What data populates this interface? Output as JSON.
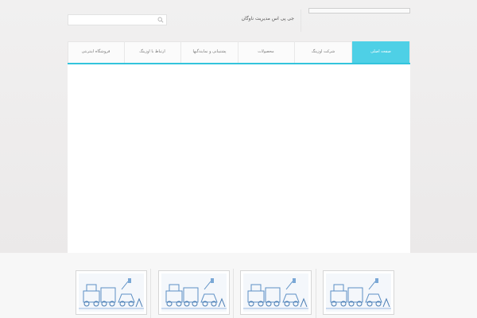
{
  "header": {
    "site_title": "جی پی اس مدیریت ناوگان",
    "search_placeholder": ""
  },
  "nav": {
    "items": [
      {
        "label": "صفحه اصلی",
        "active": true
      },
      {
        "label": "شرکت اوزینگ",
        "active": false
      },
      {
        "label": "محصولات",
        "active": false
      },
      {
        "label": "پشتیبانی و نمایندگیها",
        "active": false
      },
      {
        "label": "ارتباط با اوزینگ",
        "active": false
      },
      {
        "label": "فروشگاه اینترنتی",
        "active": false
      }
    ],
    "accent_color": "#4ed0e6"
  },
  "thumbnails": [
    {
      "icon": "fleet-illustration-icon"
    },
    {
      "icon": "fleet-illustration-icon"
    },
    {
      "icon": "fleet-illustration-icon"
    },
    {
      "icon": "fleet-illustration-icon"
    }
  ]
}
